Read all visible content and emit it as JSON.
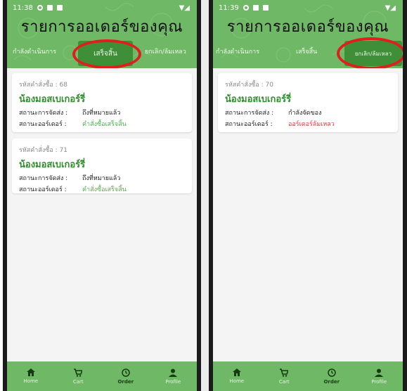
{
  "screens": [
    {
      "status": {
        "time": "11:38"
      },
      "title": "รายการออเดอร์ของคุณ",
      "tabs": {
        "pending": "กำลังดำเนินการ",
        "completed": "เสร็จสิ้น",
        "cancelled": "ยกเลิก/ล้มเหลว"
      },
      "active_tab": "completed",
      "orders": [
        {
          "order_no": "รหัสคำสั่งซื้อ : 68",
          "shop": "น้องมอสเบเกอร์รี่",
          "delivery_label": "สถานะการจัดส่ง :",
          "delivery_value": "ถึงที่หมายแล้ว",
          "order_label": "สถานะออร์เดอร์ :",
          "order_value": "คำสั่งซื้อเสร็จสิ้น"
        },
        {
          "order_no": "รหัสคำสั่งซื้อ : 71",
          "shop": "น้องมอสเบเกอร์รี่",
          "delivery_label": "สถานะการจัดส่ง :",
          "delivery_value": "ถึงที่หมายแล้ว",
          "order_label": "สถานะออร์เดอร์ :",
          "order_value": "คำสั่งซื้อเสร็จสิ้น"
        }
      ],
      "nav": {
        "home": "Home",
        "cart": "Cart",
        "order": "Order",
        "profile": "Profile"
      }
    },
    {
      "status": {
        "time": "11:39"
      },
      "title": "รายการออเดอร์ของคุณ",
      "tabs": {
        "pending": "กำลังดำเนินการ",
        "completed": "เสร็จสิ้น",
        "cancelled": "ยกเลิก/ล้มเหลว"
      },
      "active_tab": "cancelled",
      "orders": [
        {
          "order_no": "รหัสคำสั่งซื้อ : 70",
          "shop": "น้องมอสเบเกอร์รี่",
          "delivery_label": "สถานะการจัดส่ง :",
          "delivery_value": "กำลังจัดของ",
          "order_label": "สถานะออร์เดอร์ :",
          "order_value": "ออร์เดอร์ล้มเหลว"
        }
      ],
      "nav": {
        "home": "Home",
        "cart": "Cart",
        "order": "Order",
        "profile": "Profile"
      }
    }
  ],
  "colors": {
    "header": "#6fb865",
    "active_tab": "#3f8f39",
    "shop": "#2f8f2a",
    "success": "#4caf50",
    "fail": "#e53935",
    "highlight_ring": "#e01e1e"
  },
  "icons": [
    "location-icon",
    "sim-icon",
    "card-icon",
    "wifi-icon",
    "battery-icon",
    "home-icon",
    "cart-icon",
    "order-history-icon",
    "profile-icon"
  ]
}
